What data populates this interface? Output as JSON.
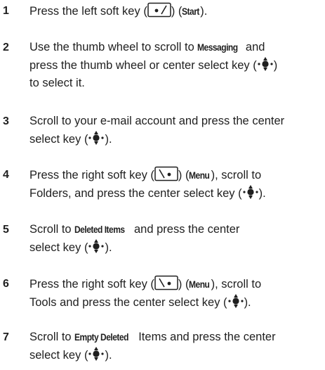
{
  "steps": [
    {
      "num": "1",
      "t1": "Press the left soft key (",
      "t2": ") (",
      "label": "Start",
      "t3": ")."
    },
    {
      "num": "2",
      "l1a": "Use the thumb wheel to scroll to ",
      "l1label": "Messaging",
      "l1b": " and",
      "l2": "press the thumb wheel or center select key (",
      "l3a": "",
      "l3b": ")",
      "l3c": "to select it."
    },
    {
      "num": "3",
      "l1": "Scroll to your e-mail account and press the center",
      "l2a": "select key (",
      "l2b": ")."
    },
    {
      "num": "4",
      "l1a": "Press the right soft key (",
      "l1b": ") (",
      "label": "Menu",
      "l1c": "), scroll to",
      "l2a": "Folders, and press the center select key (",
      "l2b": ")."
    },
    {
      "num": "5",
      "l1a": "Scroll to ",
      "label": "Deleted Items",
      "l1b": " and press the center",
      "l2a": "select key (",
      "l2b": ")."
    },
    {
      "num": "6",
      "l1a": "Press the right soft key (",
      "l1b": ") (",
      "label": "Menu",
      "l1c": "), scroll to",
      "l2a": "Tools and press the center select key (",
      "l2b": ")."
    },
    {
      "num": "7",
      "l1a": "Scroll to ",
      "label": "Empty Deleted",
      "l1b": " Items and press the center",
      "l2a": "select key (",
      "l2b": ")."
    }
  ],
  "icons": {
    "left_soft_key": "left-soft-key-icon",
    "right_soft_key": "right-soft-key-icon",
    "center_select_key": "center-select-key-icon"
  }
}
